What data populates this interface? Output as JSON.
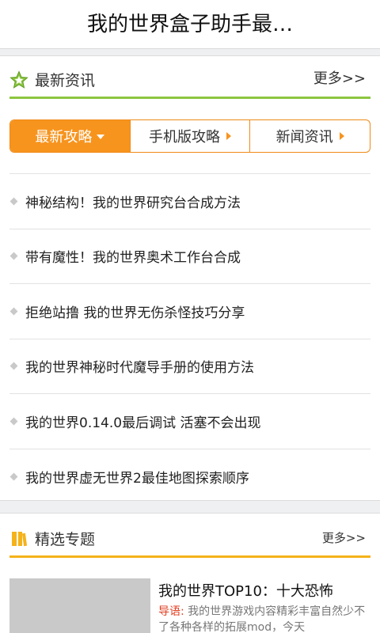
{
  "header": {
    "title": "我的世界盒子助手最…"
  },
  "news": {
    "title": "最新资讯",
    "more": "更多>>",
    "tabs": [
      {
        "label": "最新攻略"
      },
      {
        "label": "手机版攻略"
      },
      {
        "label": "新闻资讯"
      }
    ],
    "items": [
      "神秘结构！我的世界研究台合成方法",
      "带有魔性！我的世界奥术工作台合成",
      "拒绝站撸 我的世界无伤杀怪技巧分享",
      "我的世界神秘时代魔导手册的使用方法",
      "我的世界0.14.0最后调试 活塞不会出现",
      "我的世界虚无世界2最佳地图探索顺序"
    ]
  },
  "topics": {
    "title": "精选专题",
    "more": "更多>>",
    "feature": {
      "title": "我的世界TOP10：十大恐怖",
      "lead": "导语:",
      "desc": "我的世界游戏内容精彩丰富自然少不了各种各样的拓展mod，今天"
    }
  },
  "colors": {
    "accent": "#f7941e",
    "news_underline": "#8cc63f",
    "topic_underline": "#f5b21a",
    "lead": "#e03c1f"
  }
}
